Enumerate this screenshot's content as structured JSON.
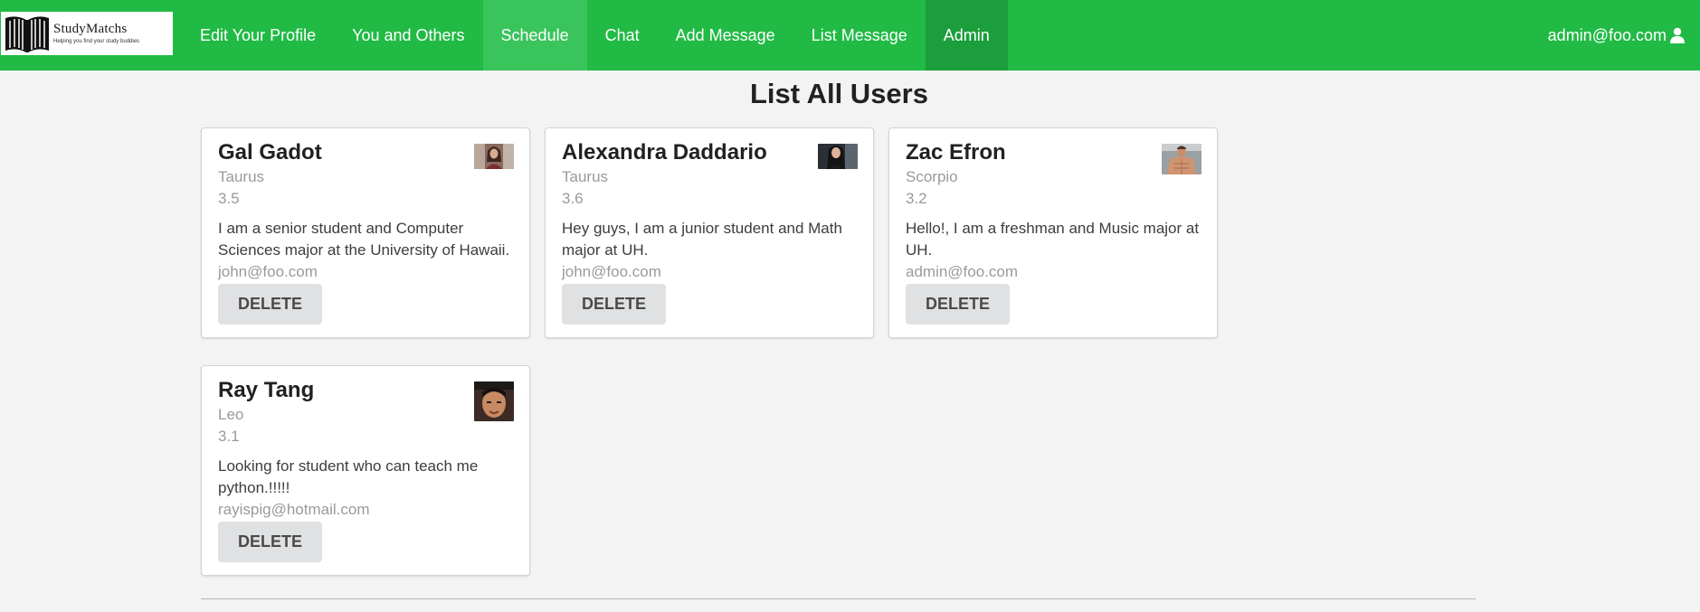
{
  "navbar": {
    "logo": {
      "brand": "StudyMatchs",
      "tagline": "Helping you find your study buddies"
    },
    "items": [
      {
        "label": "Edit Your Profile"
      },
      {
        "label": "You and Others"
      },
      {
        "label": "Schedule",
        "active": true
      },
      {
        "label": "Chat"
      },
      {
        "label": "Add Message"
      },
      {
        "label": "List Message"
      },
      {
        "label": "Admin"
      }
    ],
    "user": "admin@foo.com",
    "user_icon": "user-icon"
  },
  "main": {
    "title": "List All Users",
    "cards": [
      {
        "name": "Gal Gadot",
        "sign": "Taurus",
        "gpa": "3.5",
        "description": "I am a senior student and Computer Sciences major at the University of Hawaii.",
        "email": "john@foo.com",
        "button": "DELETE"
      },
      {
        "name": "Alexandra Daddario",
        "sign": "Taurus",
        "gpa": "3.6",
        "description": "Hey guys, I am a junior student and Math major at UH.",
        "email": "john@foo.com",
        "button": "DELETE"
      },
      {
        "name": "Zac Efron",
        "sign": "Scorpio",
        "gpa": "3.2",
        "description": "Hello!, I am a freshman and Music major at UH.",
        "email": "admin@foo.com",
        "button": "DELETE"
      },
      {
        "name": "Ray Tang",
        "sign": "Leo",
        "gpa": "3.1",
        "description": "Looking for student who can teach me python.!!!!!",
        "email": "rayispig@hotmail.com",
        "button": "DELETE"
      }
    ]
  },
  "colors": {
    "navbar": "#21ba45",
    "active_item": "#3ac45c",
    "admin_item": "#1c9e3c",
    "page_background": "#f3f3f3",
    "button": "#e0e1e2"
  }
}
